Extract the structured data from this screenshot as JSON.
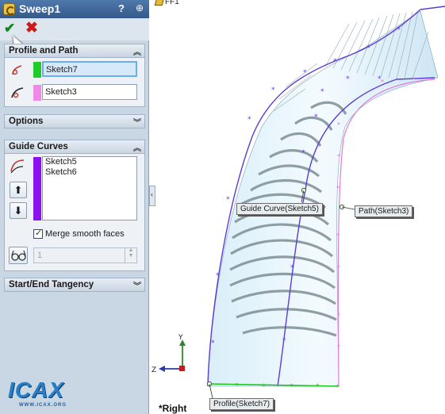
{
  "panel": {
    "title": "Sweep1",
    "help_icon": "?",
    "pin_icon": "⊕",
    "ok_icon": "check-icon",
    "cancel_icon": "close-icon"
  },
  "profile_and_path": {
    "header": "Profile and Path",
    "profile_value": "Sketch7",
    "profile_color": "#1fcc2a",
    "path_value": "Sketch3",
    "path_color": "#f08ae8"
  },
  "options": {
    "header": "Options"
  },
  "guide_curves": {
    "header": "Guide Curves",
    "color": "#8c10f2",
    "items": [
      "Sketch5",
      "Sketch6"
    ],
    "move_up": "⬆",
    "move_down": "⬇",
    "merge_label": "Merge smooth faces",
    "merge_checked": true,
    "spin_value": "1"
  },
  "tangency": {
    "header": "Start/End Tangency"
  },
  "graphics": {
    "tree_item": "FF1",
    "callouts": {
      "guide": "Guide Curve(Sketch5)",
      "path": "Path(Sketch3)",
      "profile": "Profile(Sketch7)"
    },
    "view_name": "*Right",
    "triad_y": "Y",
    "triad_z": "Z",
    "accent_blue": "#5a3cd6"
  },
  "watermark": {
    "logo": "ICAX",
    "url": "WWW.ICAX.ORG"
  }
}
